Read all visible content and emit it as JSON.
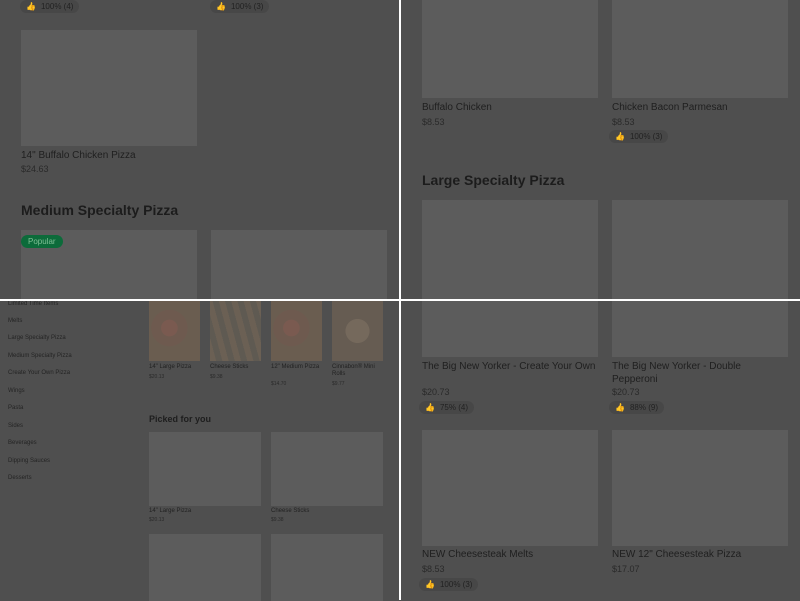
{
  "q1": {
    "top_ratings": [
      "100% (4)",
      "100% (3)"
    ],
    "item": {
      "name": "14\" Buffalo Chicken Pizza",
      "price": "$24.63"
    },
    "section_title": "Medium Specialty Pizza",
    "badge": "Popular"
  },
  "q2": {
    "items": [
      {
        "name": "Buffalo Chicken",
        "price": "$8.53"
      },
      {
        "name": "Chicken Bacon Parmesan",
        "price": "$8.53",
        "rating": "100% (3)"
      }
    ],
    "section_title": "Large Specialty Pizza"
  },
  "q3": {
    "sidebar": [
      "Limited Time Items",
      "Melts",
      "Large Specialty Pizza",
      "Medium Specialty Pizza",
      "Create Your Own Pizza",
      "Wings",
      "Pasta",
      "Sides",
      "Beverages",
      "Dipping Sauces",
      "Desserts"
    ],
    "thumbs": [
      {
        "name": "14\" Large Pizza",
        "price": "$20.13"
      },
      {
        "name": "Cheese Sticks",
        "price": "$9.38"
      },
      {
        "name": "12\" Medium Pizza",
        "price": "$14.70"
      },
      {
        "name": "Cinnabon® Mini Rolls",
        "price": "$9.77"
      }
    ],
    "picked_title": "Picked for you",
    "picked": [
      {
        "name": "14\" Large Pizza",
        "price": "$20.13"
      },
      {
        "name": "Cheese Sticks",
        "price": "$9.38"
      }
    ]
  },
  "q4": {
    "items": [
      {
        "name": "The Big New Yorker - Create Your Own",
        "price": "$20.73",
        "rating": "75% (4)"
      },
      {
        "name": "The Big New Yorker - Double Pepperoni",
        "price": "$20.73",
        "rating": "88% (9)"
      },
      {
        "name": "NEW Cheesesteak Melts",
        "price": "$8.53",
        "rating": "100% (3)"
      },
      {
        "name": "NEW 12\" Cheesesteak Pizza",
        "price": "$17.07"
      }
    ]
  }
}
